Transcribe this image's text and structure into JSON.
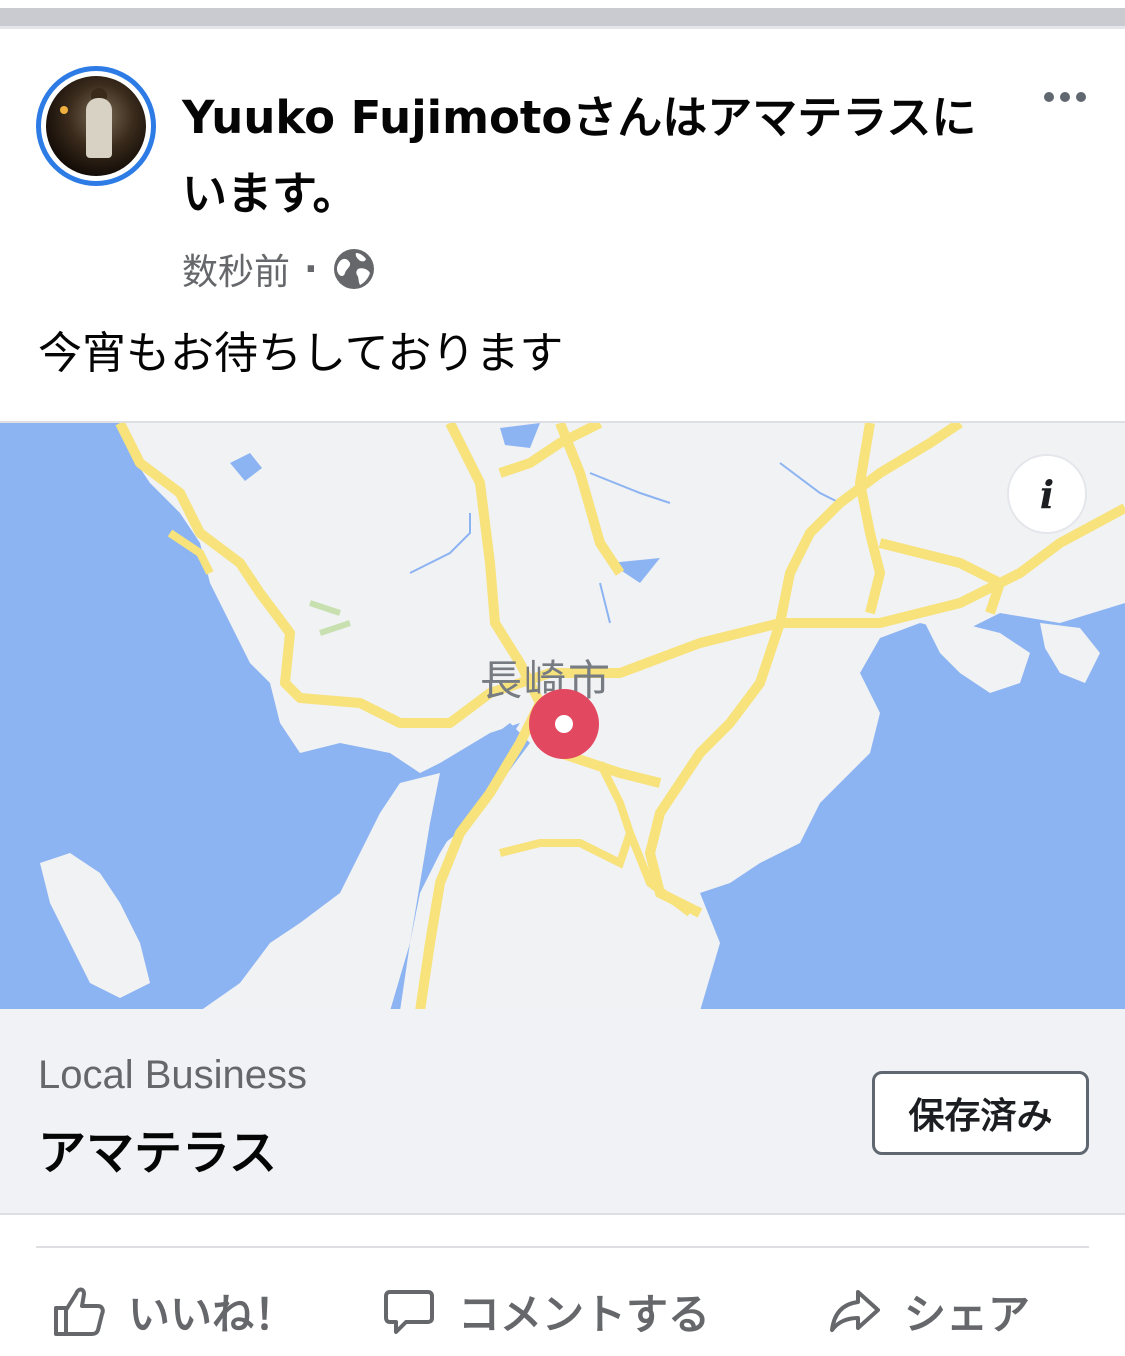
{
  "post": {
    "author": "Yuuko Fujimoto",
    "title": "Yuuko Fujimotoさんはアマテラスにいます。",
    "timestamp": "数秒前",
    "separator": "·",
    "privacy_icon": "globe-icon",
    "text": "今宵もお待ちしております"
  },
  "map": {
    "city_label": "長崎市",
    "info_label": "i",
    "colors": {
      "sea": "#8db4f2",
      "land": "#f1f2f4",
      "road": "#f7e27b",
      "pin": "#e2485f"
    }
  },
  "business": {
    "category": "Local Business",
    "name": "アマテラス",
    "save_label": "保存済み"
  },
  "actions": {
    "like_label": "いいね！",
    "comment_label": "コメントする",
    "share_label": "シェア"
  }
}
